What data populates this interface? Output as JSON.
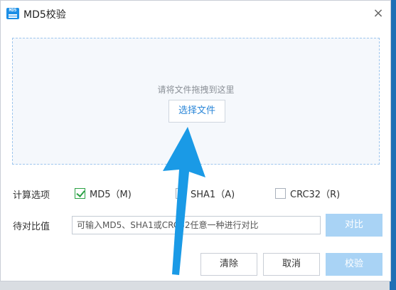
{
  "window": {
    "title": "MD5校验",
    "icon_name": "md5-app-icon",
    "icon_text": "MD5",
    "close_label": "×"
  },
  "dropzone": {
    "hint": "请将文件拖拽到这里",
    "choose_button": "选择文件"
  },
  "options": {
    "label": "计算选项",
    "items": [
      {
        "label": "MD5（M)",
        "checked": true
      },
      {
        "label": "SHA1（A)",
        "checked": false
      },
      {
        "label": "CRC32（R)",
        "checked": false
      }
    ]
  },
  "compare": {
    "label": "待对比值",
    "placeholder": "可输入MD5、SHA1或CRC32任意一种进行对比",
    "button": "对比"
  },
  "footer": {
    "clear": "清除",
    "cancel": "取消",
    "primary": "校验"
  },
  "colors": {
    "accent": "#1c8fe6",
    "arrow": "#1a9ae6",
    "disabled_button": "#a9d3f5",
    "checkbox_check": "#2ba245"
  }
}
